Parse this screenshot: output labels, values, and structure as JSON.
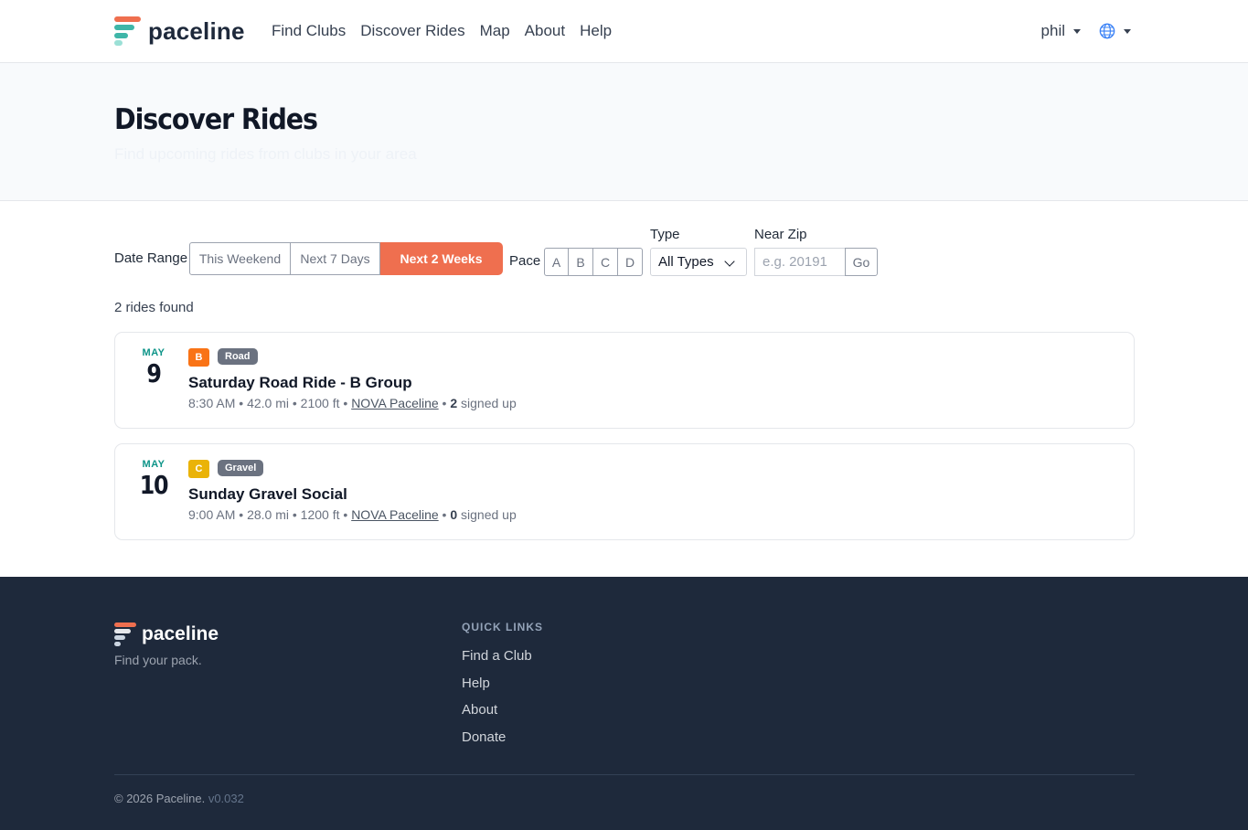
{
  "navbar": {
    "brand": "paceline",
    "links": [
      "Find Clubs",
      "Discover Rides",
      "Map",
      "About",
      "Help"
    ],
    "user": "phil",
    "language_icon": "globe-icon"
  },
  "hero": {
    "title": "Discover Rides",
    "subtitle": "Find upcoming rides from clubs in your area"
  },
  "filters": {
    "date_range_label": "Date Range",
    "date_options": [
      "This Weekend",
      "Next 7 Days",
      "Next 2 Weeks"
    ],
    "date_selected": "Next 2 Weeks",
    "pace_label": "Pace",
    "pace_options": [
      "A",
      "B",
      "C",
      "D"
    ],
    "type_label": "Type",
    "type_value": "All Types",
    "zip_label": "Near Zip",
    "zip_placeholder": "e.g. 20191",
    "go_label": "Go"
  },
  "results_count": "2 rides found",
  "rides": [
    {
      "month": "MAY",
      "day": "9",
      "pace": "B",
      "pace_color": "#f97316",
      "type": "Road",
      "title": "Saturday Road Ride - B Group",
      "time": "8:30 AM",
      "distance": "42.0 mi",
      "elevation": "2100 ft",
      "club": "NOVA Paceline",
      "signed_count": "2",
      "signed_label": "signed up"
    },
    {
      "month": "MAY",
      "day": "10",
      "pace": "C",
      "pace_color": "#eab308",
      "type": "Gravel",
      "title": "Sunday Gravel Social",
      "time": "9:00 AM",
      "distance": "28.0 mi",
      "elevation": "1200 ft",
      "club": "NOVA Paceline",
      "signed_count": "0",
      "signed_label": "signed up"
    }
  ],
  "footer": {
    "brand": "paceline",
    "tagline": "Find your pack.",
    "quick_links_heading": "QUICK LINKS",
    "quick_links": [
      "Find a Club",
      "Help",
      "About",
      "Donate"
    ],
    "copyright": "© 2026 Paceline.",
    "version": "v0.032"
  },
  "colors": {
    "accent": "#ef6f4f",
    "teal": "#0d9488",
    "footer_bg": "#1e293b"
  }
}
